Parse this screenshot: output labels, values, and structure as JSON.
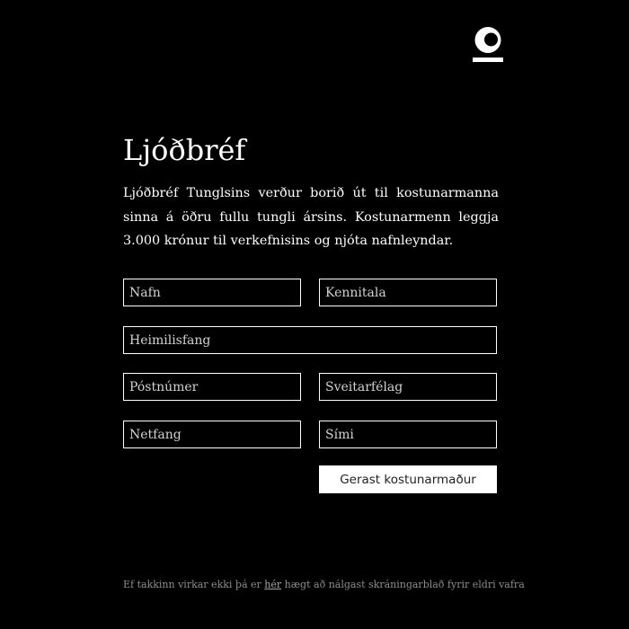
{
  "logo": {
    "icon": "moon-logo-icon"
  },
  "page": {
    "title": "Ljóðbréf",
    "intro": "Ljóðbréf Tunglsins verður borið út til kostunarmanna sinna á öðru fullu tungli ársins. Kostunarmenn leggja 3.000 krónur til verkefnisins og njóta nafnleyndar."
  },
  "form": {
    "fields": {
      "name": {
        "placeholder": "Nafn",
        "value": ""
      },
      "kennitala": {
        "placeholder": "Kennitala",
        "value": ""
      },
      "address": {
        "placeholder": "Heimilisfang",
        "value": ""
      },
      "postcode": {
        "placeholder": "Póstnúmer",
        "value": ""
      },
      "municipality": {
        "placeholder": "Sveitarfélag",
        "value": ""
      },
      "email": {
        "placeholder": "Netfang",
        "value": ""
      },
      "phone": {
        "placeholder": "Sími",
        "value": ""
      }
    },
    "submit_label": "Gerast kostunarmaður"
  },
  "footer": {
    "text_before": "Ef takkinn virkar ekki þá er ",
    "link_label": "hér",
    "text_after": " hægt að nálgast skráningarblað fyrir eldri vafra"
  },
  "colors": {
    "background": "#000000",
    "foreground": "#ffffff",
    "footer_text": "#8c8c8c"
  }
}
